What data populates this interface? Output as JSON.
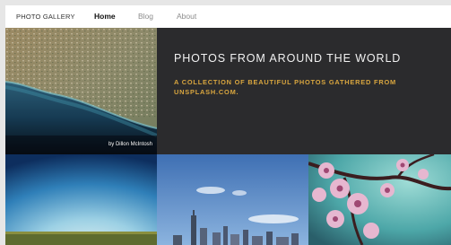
{
  "navbar": {
    "brand": "PHOTO GALLERY",
    "links": [
      {
        "label": "Home",
        "active": true
      },
      {
        "label": "Blog",
        "active": false
      },
      {
        "label": "About",
        "active": false
      }
    ]
  },
  "hero": {
    "title": "PHOTOS FROM AROUND THE WORLD",
    "subtitle": "A COLLECTION OF BEAUTIFUL PHOTOS GATHERED FROM UNSPLASH.COM."
  },
  "tiles": {
    "coast": {
      "credit": "by Dillon McIntosh"
    }
  },
  "colors": {
    "accent": "#d9a63f",
    "hero_background": "#2b2b2d",
    "navbar_background": "#ffffff"
  }
}
